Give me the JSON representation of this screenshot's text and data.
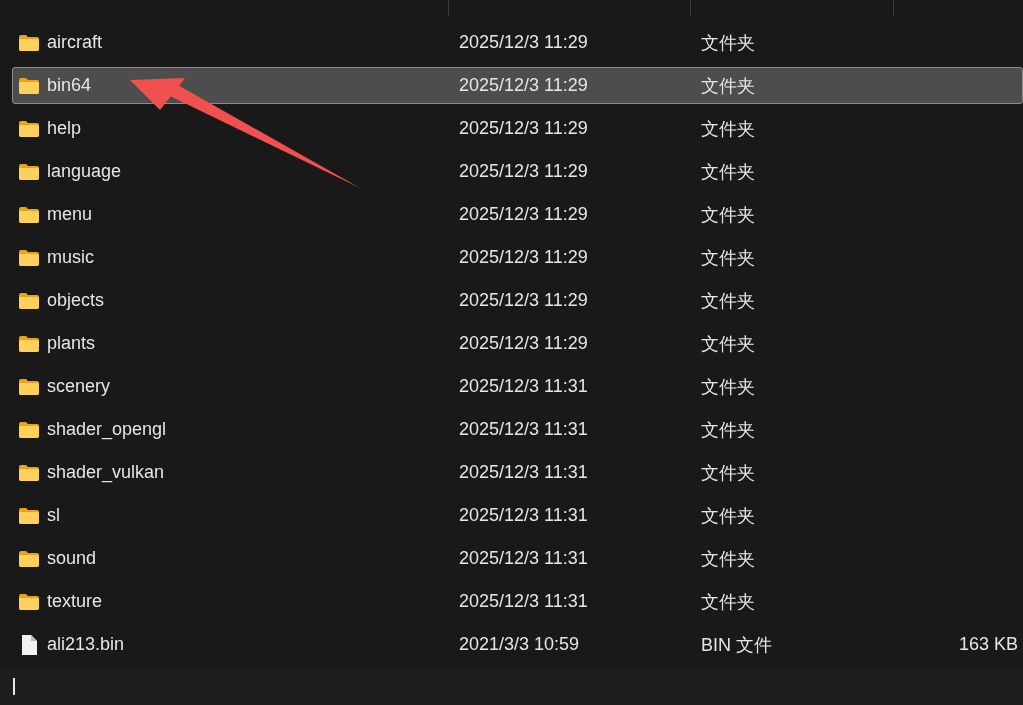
{
  "file_list": {
    "rows": [
      {
        "kind": "folder",
        "name": "aircraft",
        "modified": "2025/12/3 11:29",
        "type": "文件夹",
        "selected": false
      },
      {
        "kind": "folder",
        "name": "bin64",
        "modified": "2025/12/3 11:29",
        "type": "文件夹",
        "selected": true
      },
      {
        "kind": "folder",
        "name": "help",
        "modified": "2025/12/3 11:29",
        "type": "文件夹",
        "selected": false
      },
      {
        "kind": "folder",
        "name": "language",
        "modified": "2025/12/3 11:29",
        "type": "文件夹",
        "selected": false
      },
      {
        "kind": "folder",
        "name": "menu",
        "modified": "2025/12/3 11:29",
        "type": "文件夹",
        "selected": false
      },
      {
        "kind": "folder",
        "name": "music",
        "modified": "2025/12/3 11:29",
        "type": "文件夹",
        "selected": false
      },
      {
        "kind": "folder",
        "name": "objects",
        "modified": "2025/12/3 11:29",
        "type": "文件夹",
        "selected": false
      },
      {
        "kind": "folder",
        "name": "plants",
        "modified": "2025/12/3 11:29",
        "type": "文件夹",
        "selected": false
      },
      {
        "kind": "folder",
        "name": "scenery",
        "modified": "2025/12/3 11:31",
        "type": "文件夹",
        "selected": false
      },
      {
        "kind": "folder",
        "name": "shader_opengl",
        "modified": "2025/12/3 11:31",
        "type": "文件夹",
        "selected": false
      },
      {
        "kind": "folder",
        "name": "shader_vulkan",
        "modified": "2025/12/3 11:31",
        "type": "文件夹",
        "selected": false
      },
      {
        "kind": "folder",
        "name": "sl",
        "modified": "2025/12/3 11:31",
        "type": "文件夹",
        "selected": false
      },
      {
        "kind": "folder",
        "name": "sound",
        "modified": "2025/12/3 11:31",
        "type": "文件夹",
        "selected": false
      },
      {
        "kind": "folder",
        "name": "texture",
        "modified": "2025/12/3 11:31",
        "type": "文件夹",
        "selected": false
      },
      {
        "kind": "file",
        "name": "ali213.bin",
        "modified": "2021/3/3 10:59",
        "type": "BIN 文件",
        "size": "163 KB",
        "selected": false
      }
    ]
  }
}
